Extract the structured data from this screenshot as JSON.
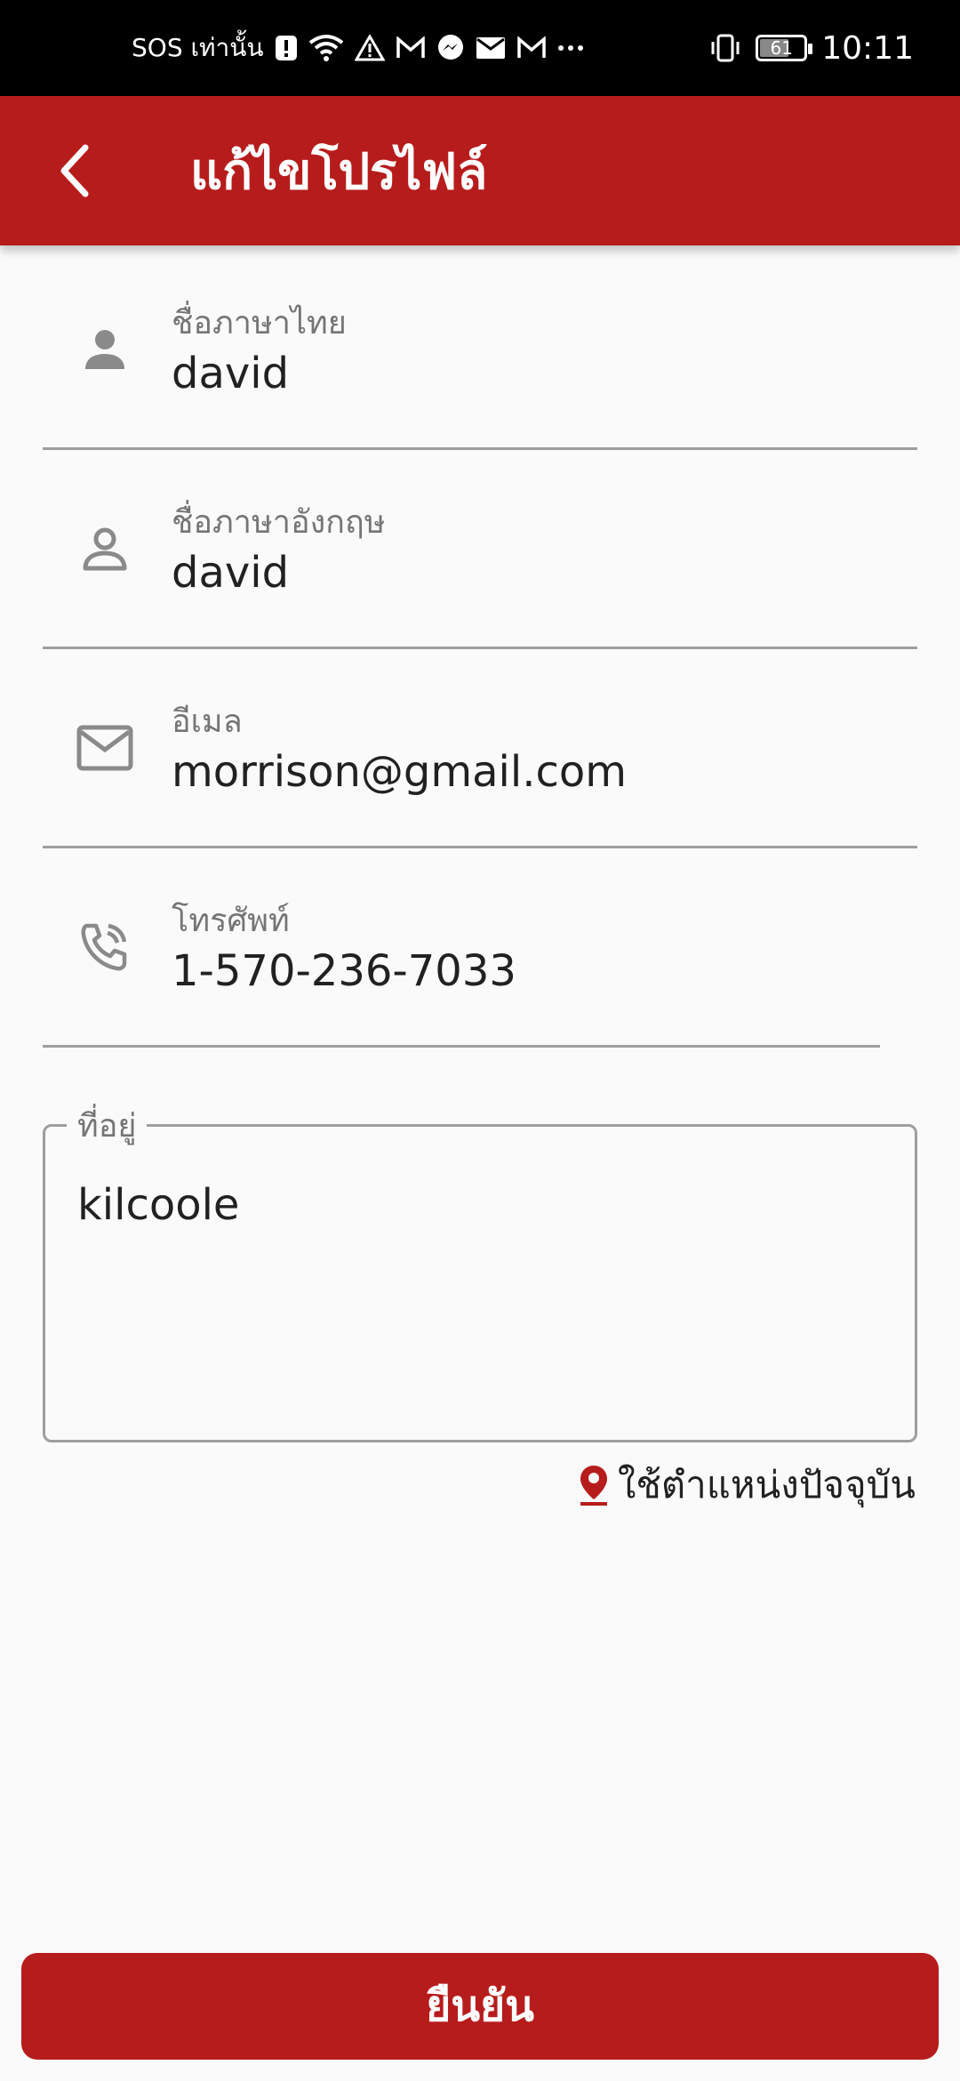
{
  "status_bar": {
    "carrier": "SOS เท่านั้น",
    "time": "10:11",
    "battery": "61",
    "battery_level_percent": 61,
    "icons": [
      "alert-badge-icon",
      "wifi-icon",
      "warning-icon",
      "gmail-icon",
      "messenger-icon",
      "mail-icon",
      "gmail-icon",
      "more-icon",
      "vibrate-icon",
      "battery-icon"
    ]
  },
  "app_bar": {
    "title": "แก้ไขโปรไฟล์",
    "back_icon": "chevron-left-icon",
    "background": "#b71c1c"
  },
  "form": {
    "fields": [
      {
        "label": "ชื่อภาษาไทย",
        "value": "david",
        "icon": "person-filled-icon"
      },
      {
        "label": "ชื่อภาษาอังกฤษ",
        "value": "david",
        "icon": "person-outline-icon"
      },
      {
        "label": "อีเมล",
        "value": "morrison@gmail.com",
        "icon": "mail-icon"
      },
      {
        "label": "โทรศัพท์",
        "value": "1-570-236-7033",
        "icon": "phone-icon"
      }
    ],
    "address": {
      "label": "ที่อยู่",
      "value": "kilcoole"
    },
    "use_location": {
      "label": "ใช้ตำแหน่งปัจจุบัน",
      "icon": "location-pin-icon",
      "icon_color": "#b71c1c"
    }
  },
  "confirm_button": {
    "label": "ยืนยัน",
    "background": "#b71c1c"
  }
}
